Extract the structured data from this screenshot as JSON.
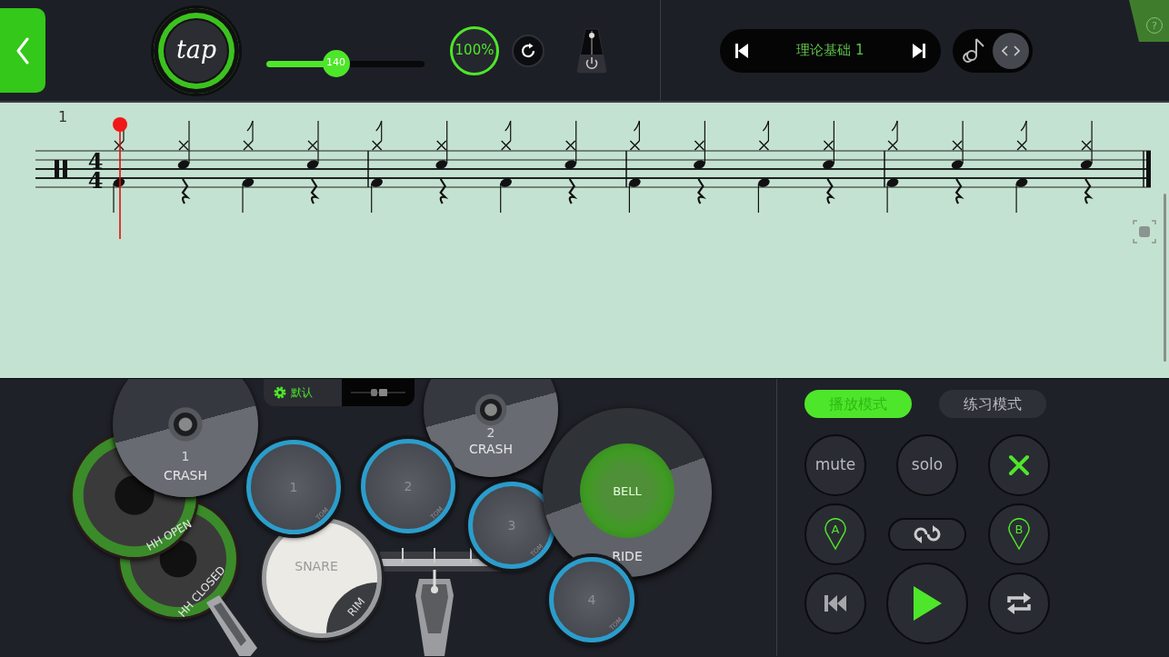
{
  "toolbar": {
    "tap_label": "tap",
    "tempo": {
      "value": "140",
      "level": 0.44
    },
    "speed": "100%",
    "song_title": "理论基础 1",
    "help": "?"
  },
  "score": {
    "measure_number": "1",
    "time_signature": {
      "numerator": "4",
      "denominator": "4"
    }
  },
  "kit": {
    "preset": "默认",
    "pads": [
      {
        "kind": "cymbal",
        "number": "1",
        "label": "CRASH"
      },
      {
        "kind": "hihat",
        "label": "HH OPEN"
      },
      {
        "kind": "hihat",
        "label": "HH CLOSED"
      },
      {
        "kind": "tom",
        "number": "1",
        "label": "TOM"
      },
      {
        "kind": "tom",
        "number": "2",
        "label": "TOM"
      },
      {
        "kind": "snare",
        "label": "SNARE",
        "rim_label": "RIM"
      },
      {
        "kind": "cymbal",
        "number": "2",
        "label": "CRASH"
      },
      {
        "kind": "tom",
        "number": "3",
        "label": "TOM"
      },
      {
        "kind": "ride",
        "bell_label": "BELL",
        "label": "RIDE"
      },
      {
        "kind": "tom",
        "number": "4",
        "label": "TOM"
      }
    ]
  },
  "modes": [
    {
      "label": "播放模式",
      "selected": true
    },
    {
      "label": "练习模式",
      "selected": false
    }
  ],
  "controls": [
    {
      "kind": "text",
      "label": "mute"
    },
    {
      "kind": "text",
      "label": "solo"
    },
    {
      "kind": "clear"
    },
    {
      "kind": "marker",
      "label": "A"
    },
    {
      "kind": "loop"
    },
    {
      "kind": "marker",
      "label": "B"
    },
    {
      "kind": "rewind"
    },
    {
      "kind": "play"
    },
    {
      "kind": "repeat"
    }
  ]
}
